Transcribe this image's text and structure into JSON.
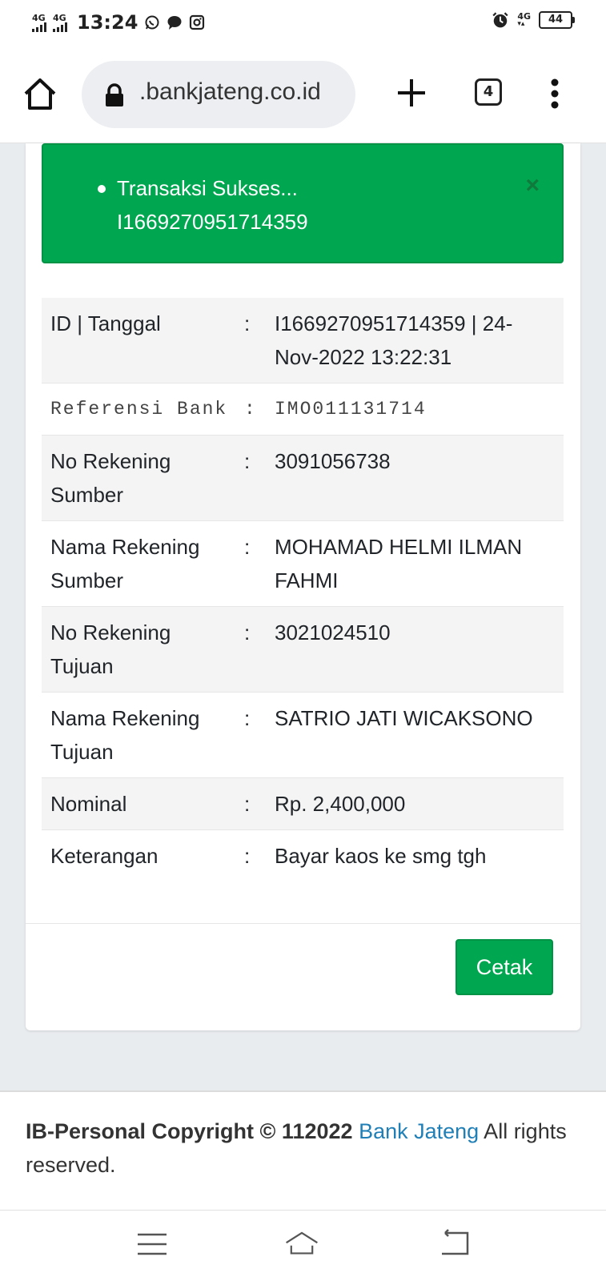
{
  "status_bar": {
    "network1": "4G",
    "network2": "4G",
    "time": "13:24",
    "network3": "4G",
    "battery": "44",
    "icons": [
      "whatsapp-icon",
      "chat-bubble-icon",
      "instagram-icon",
      "alarm-icon"
    ]
  },
  "browser": {
    "url": ".bankjateng.co.id",
    "tab_count": "4"
  },
  "alert": {
    "line1": "Transaksi Sukses...",
    "line2": "I1669270951714359",
    "close": "×",
    "color": "#00a650"
  },
  "details": [
    {
      "label": "ID | Tanggal",
      "sep": ":",
      "value": "I1669270951714359 | 24-Nov-2022 13:22:31"
    },
    {
      "label": "Referensi Bank",
      "sep": ":",
      "value": "IMO011131714"
    },
    {
      "label": "No Rekening Sumber",
      "sep": ":",
      "value": "3091056738"
    },
    {
      "label": "Nama Rekening Sumber",
      "sep": ":",
      "value": "MOHAMAD HELMI ILMAN FAHMI"
    },
    {
      "label": "No Rekening Tujuan",
      "sep": ":",
      "value": "3021024510"
    },
    {
      "label": "Nama Rekening Tujuan",
      "sep": ":",
      "value": "SATRIO JATI WICAKSONO"
    },
    {
      "label": "Nominal",
      "sep": ":",
      "value": "Rp. 2,400,000"
    },
    {
      "label": "Keterangan",
      "sep": ":",
      "value": "Bayar kaos ke smg tgh"
    }
  ],
  "print_button": "Cetak",
  "footer": {
    "copyright": "IB-Personal Copyright © 112022",
    "link": "Bank Jateng",
    "rest": " All rights reserved.",
    "link_color": "#1f7fb6"
  }
}
